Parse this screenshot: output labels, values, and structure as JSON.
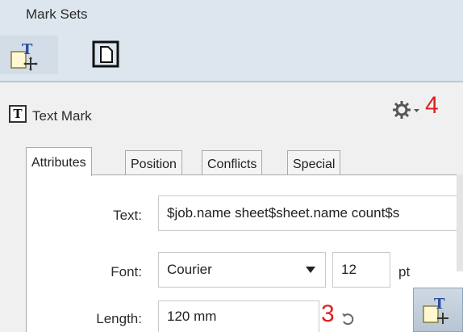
{
  "header": {
    "title": "Mark Sets",
    "mark_type_tabs": [
      {
        "name": "text-mark-add",
        "icon": "text-mark-add-icon"
      },
      {
        "name": "page-mark",
        "icon": "page-icon"
      }
    ]
  },
  "panel": {
    "title": "Text Mark",
    "title_icon_glyph": "T",
    "annotation_top": "4"
  },
  "tabs": [
    "Attributes",
    "Position",
    "Conflicts",
    "Special"
  ],
  "form": {
    "text_label": "Text:",
    "text_value": "$job.name sheet$sheet.name count$s",
    "font_label": "Font:",
    "font_value": "Courier",
    "font_size": "12",
    "font_size_unit": "pt",
    "length_label": "Length:",
    "length_value": "120 mm",
    "annotation_length": "3"
  },
  "colors": {
    "annotation": "#e02020",
    "header_bg": "#dde6ee"
  }
}
